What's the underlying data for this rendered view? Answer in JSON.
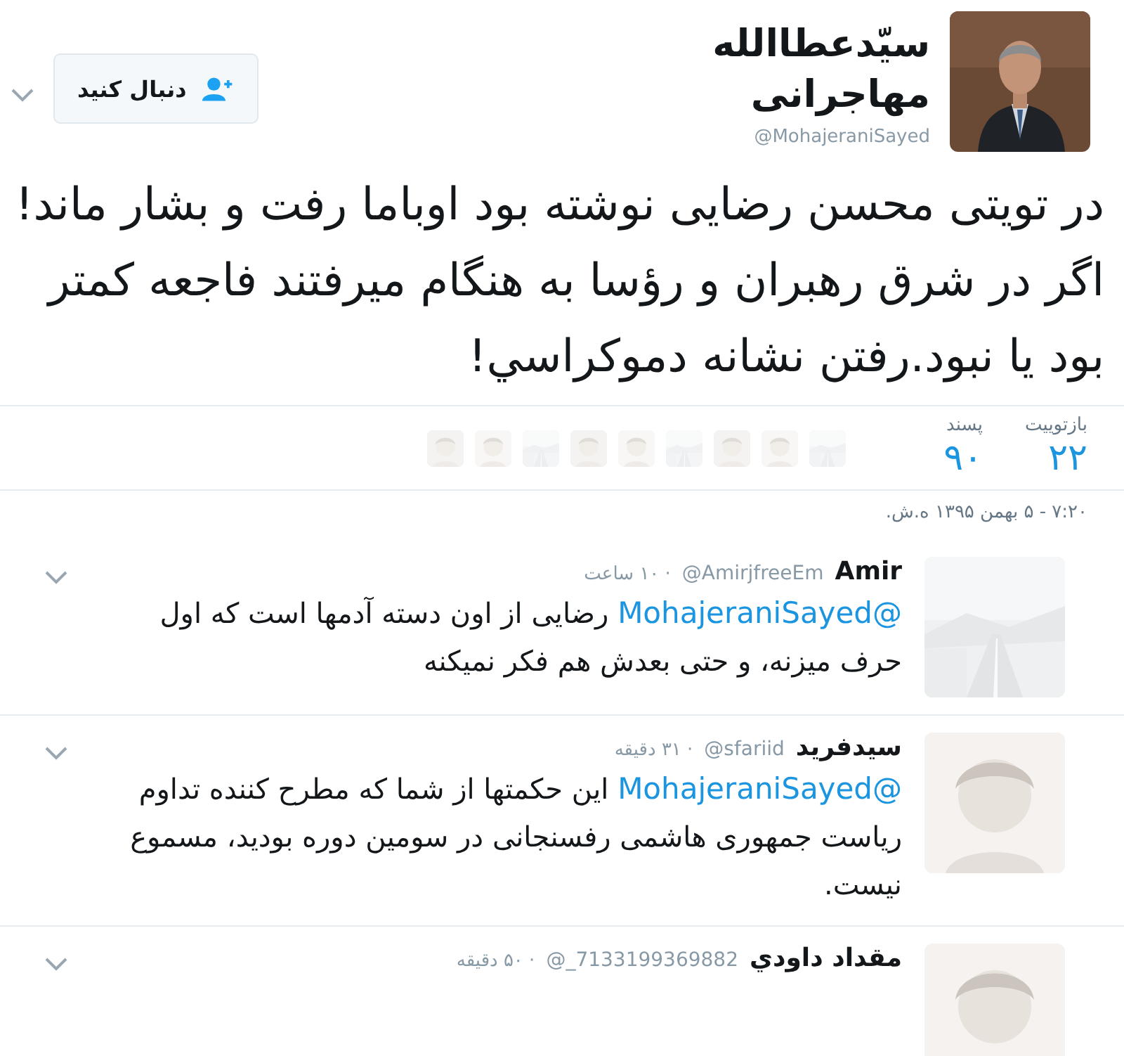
{
  "profile": {
    "name": "سیّدعطاالله مهاجرانی",
    "handle": "@MohajeraniSayed"
  },
  "follow_button": {
    "label": "دنبال کنید"
  },
  "tweet": {
    "text": "در تویتی محسن رضایی نوشته بود اوباما رفت و بشار ماند! اگر در شرق رهبران و رؤسا به هنگام میرفتند فاجعه کمتر بود یا نبود.رفتن نشانه دموکراسي!",
    "stats": [
      {
        "label": "بازتوییت",
        "count": "۲۲"
      },
      {
        "label": "پسند",
        "count": "۹۰"
      }
    ],
    "timestamp": "۷:۲۰ - ۵ بهمن ۱۳۹۵ ه.ش."
  },
  "replies": [
    {
      "name": "Amir",
      "handle": "@AmirjfreeEm",
      "time": "· ۱۰ ساعت",
      "mention": "@MohajeraniSayed",
      "text": "رضایی از اون دسته آدمها است که اول حرف میزنه، و حتی بعدش هم فکر نمیکنه"
    },
    {
      "name": "سیدفرید",
      "handle": "@sfariid",
      "time": "· ۳۱ دقیقه",
      "mention": "@MohajeraniSayed",
      "text": "این حکمتها از شما که مطرح کننده تداوم ریاست جمهوری هاشمی رفسنجانی در سومین دوره بودید، مسموع نیست."
    },
    {
      "name": "مقداد داودي",
      "handle": "@_7133199369882",
      "time": "· ۵۰ دقیقه"
    }
  ]
}
